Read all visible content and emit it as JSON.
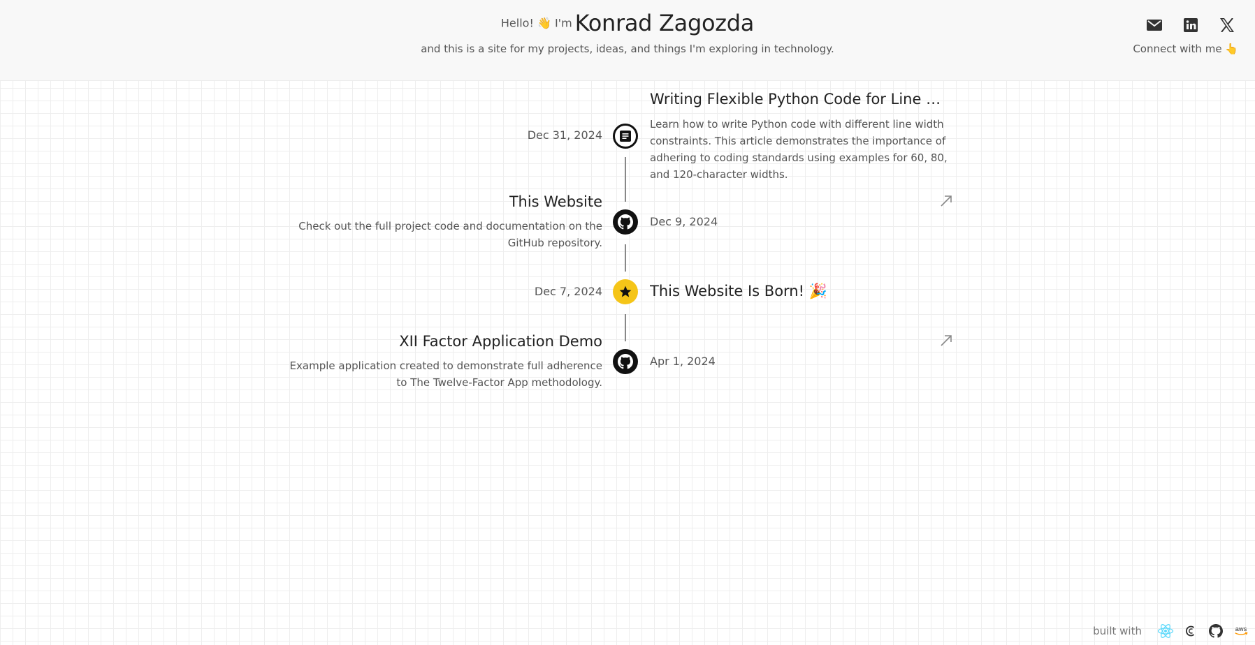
{
  "header": {
    "hello": "Hello! 👋 I'm",
    "name": "Konrad Zagozda",
    "subtitle": "and this is a site for my projects, ideas, and things I'm exploring in technology.",
    "socials": [
      {
        "icon": "email-icon"
      },
      {
        "icon": "linkedin-icon"
      },
      {
        "icon": "x-icon"
      }
    ],
    "connect": "Connect with me 👆"
  },
  "timeline": [
    {
      "date": "Dec 31, 2024",
      "title": "Writing Flexible Python Code for Line Width Constraints",
      "description": "Learn how to write Python code with different line width constraints. This article demonstrates the importance of adhering to coding standards using examples for 60, 80, and 120-character widths.",
      "icon": "article-icon",
      "side": "right"
    },
    {
      "date": "Dec 9, 2024",
      "title": "This Website",
      "description": "Check out the full project code and documentation on the GitHub repository.",
      "icon": "github-icon",
      "side": "left"
    },
    {
      "date": "Dec 7, 2024",
      "title": "This Website Is Born! 🎉",
      "icon": "star-icon",
      "side": "right"
    },
    {
      "date": "Apr 1, 2024",
      "title": "XII Factor Application Demo",
      "description": "Example application created to demonstrate full adherence to The Twelve-Factor App methodology.",
      "icon": "github-icon",
      "side": "left"
    }
  ],
  "footer": {
    "built_with": "built with",
    "icons": [
      "react-icon",
      "contentful-icon",
      "github-icon",
      "aws-icon"
    ],
    "aws_text": "aws"
  },
  "colors": {
    "accent_star": "#f5c518",
    "node_dark": "#111111",
    "connector": "#888888",
    "react": "#61dafb"
  }
}
